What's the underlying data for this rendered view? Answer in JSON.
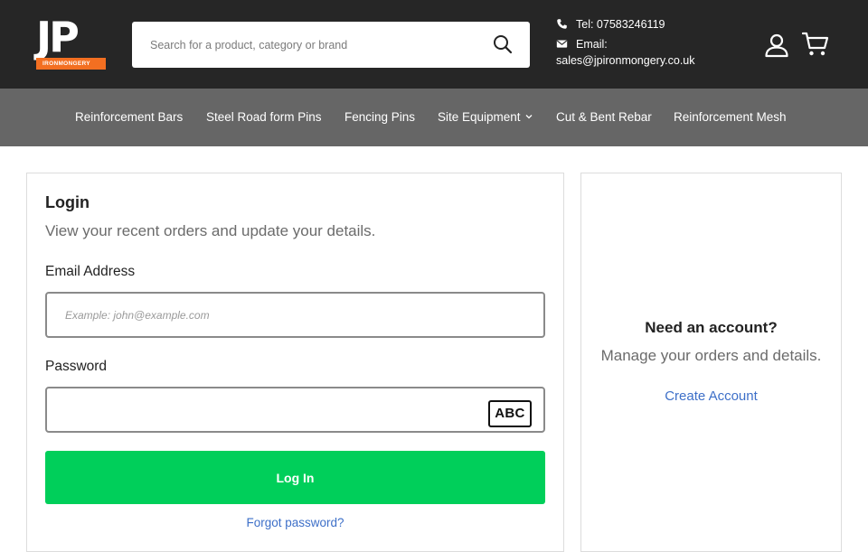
{
  "brand": {
    "logo_letters": "JP",
    "logo_sub": "IRONMONGERY",
    "accent_color": "#f36f21"
  },
  "search": {
    "placeholder": "Search for a product, category or brand",
    "icon": "search-icon"
  },
  "contact": {
    "tel": "Tel: 07583246119",
    "email_label": "Email:",
    "email_value": "sales@jpironmongery.co.uk"
  },
  "header_icons": [
    "account-icon",
    "cart-icon"
  ],
  "nav": {
    "items": [
      {
        "label": "Reinforcement Bars"
      },
      {
        "label": "Steel Road form Pins"
      },
      {
        "label": "Fencing Pins"
      },
      {
        "label": "Site Equipment"
      },
      {
        "label": "Cut & Bent Rebar"
      },
      {
        "label": "Reinforcement Mesh"
      }
    ]
  },
  "login": {
    "title": "Login",
    "subtitle": "View your recent orders and update your details.",
    "email_label": "Email Address",
    "email_placeholder": "Example: john@example.com",
    "password_label": "Password",
    "password_badge": "ABC",
    "submit_label": "Log In",
    "forgot_label": "Forgot password?",
    "button_color": "#00cf5a"
  },
  "account": {
    "title": "Need an account?",
    "subtitle": "Manage your orders and details.",
    "create_label": "Create Account",
    "link_color": "#3d6fc8"
  }
}
